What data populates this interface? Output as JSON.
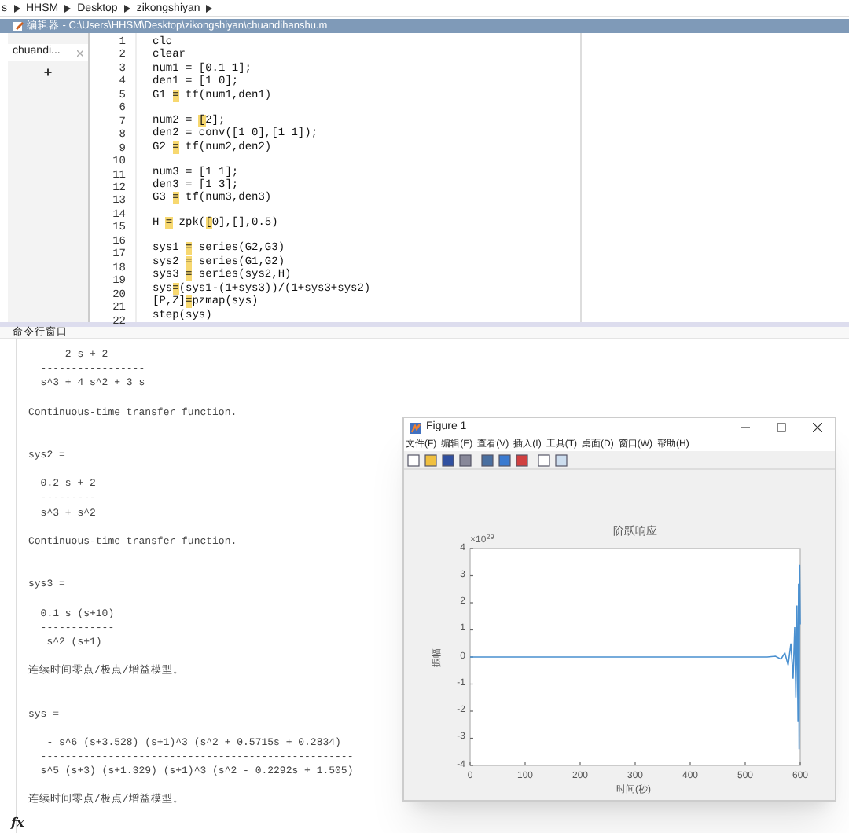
{
  "breadcrumb": [
    "s",
    "HHSM",
    "Desktop",
    "zikongshiyan"
  ],
  "editor": {
    "title": "编辑器 - C:\\Users\\HHSM\\Desktop\\zikongshiyan\\chuandihanshu.m",
    "file_tabs": [
      {
        "label": "chuandi...",
        "selected": true
      }
    ],
    "add_tab": "+",
    "lines": [
      {
        "number": "1",
        "segments": [
          {
            "text": "clc",
            "highlight": false
          }
        ]
      },
      {
        "number": "2",
        "segments": [
          {
            "text": "clear",
            "highlight": false
          }
        ]
      },
      {
        "number": "3",
        "segments": [
          {
            "text": "num1 = [0.1 1];",
            "highlight": false
          }
        ]
      },
      {
        "number": "4",
        "segments": [
          {
            "text": "den1 = [1 0];",
            "highlight": false
          }
        ]
      },
      {
        "number": "5",
        "segments": [
          {
            "text": "G1 ",
            "highlight": false
          },
          {
            "text": "=",
            "highlight": true
          },
          {
            "text": " tf(num1,den1)",
            "highlight": false
          }
        ]
      },
      {
        "number": "6"
      },
      {
        "number": "7",
        "segments": [
          {
            "text": "num2 = ",
            "highlight": false
          },
          {
            "text": "[",
            "highlight": true
          },
          {
            "text": "2];",
            "highlight": false
          }
        ]
      },
      {
        "number": "8",
        "segments": [
          {
            "text": "den2 = conv([1 0],[1 1]);",
            "highlight": false
          }
        ]
      },
      {
        "number": "9",
        "segments": [
          {
            "text": "G2 ",
            "highlight": false
          },
          {
            "text": "=",
            "highlight": true
          },
          {
            "text": " tf(num2,den2)",
            "highlight": false
          }
        ]
      },
      {
        "number": "10"
      },
      {
        "number": "11",
        "segments": [
          {
            "text": "num3 = [1 1];",
            "highlight": false
          }
        ]
      },
      {
        "number": "12",
        "segments": [
          {
            "text": "den3 = [1 3];",
            "highlight": false
          }
        ]
      },
      {
        "number": "13",
        "segments": [
          {
            "text": "G3 ",
            "highlight": false
          },
          {
            "text": "=",
            "highlight": true
          },
          {
            "text": " tf(num3,den3)",
            "highlight": false
          }
        ]
      },
      {
        "number": "14"
      },
      {
        "number": "15",
        "segments": [
          {
            "text": "H ",
            "highlight": false
          },
          {
            "text": "=",
            "highlight": true
          },
          {
            "text": " zpk(",
            "highlight": false
          },
          {
            "text": "[",
            "highlight": true
          },
          {
            "text": "0],[],0.5)",
            "highlight": false
          }
        ]
      },
      {
        "number": "16"
      },
      {
        "number": "17",
        "segments": [
          {
            "text": "sys1 ",
            "highlight": false
          },
          {
            "text": "=",
            "highlight": true
          },
          {
            "text": " series(G2,G3)",
            "highlight": false
          }
        ]
      },
      {
        "number": "18",
        "segments": [
          {
            "text": "sys2 ",
            "highlight": false
          },
          {
            "text": "=",
            "highlight": true
          },
          {
            "text": " series(G1,G2)",
            "highlight": false
          }
        ]
      },
      {
        "number": "19",
        "segments": [
          {
            "text": "sys3 ",
            "highlight": false
          },
          {
            "text": "=",
            "highlight": true
          },
          {
            "text": " series(sys2,H)",
            "highlight": false
          }
        ]
      },
      {
        "number": "20",
        "segments": [
          {
            "text": "sys",
            "highlight": false
          },
          {
            "text": "=",
            "highlight": true
          },
          {
            "text": "(sys1-(1+sys3))/(1+sys3+sys2)",
            "highlight": false
          }
        ]
      },
      {
        "number": "21",
        "segments": [
          {
            "text": "[P,Z]",
            "highlight": false
          },
          {
            "text": "=",
            "highlight": true
          },
          {
            "text": "pzmap(sys)",
            "highlight": false
          }
        ]
      },
      {
        "number": "22",
        "segments": [
          {
            "text": "step(sys)",
            "highlight": false
          }
        ]
      }
    ]
  },
  "command_window": {
    "title": "命令行窗口",
    "lines": [
      {
        "kind": "text",
        "text": "      2 s + 2"
      },
      {
        "kind": "text",
        "text": "  -----------------"
      },
      {
        "kind": "text",
        "text": "  s^3 + 4 s^2 + 3 s"
      },
      {
        "kind": "blank"
      },
      {
        "kind": "text",
        "text": "Continuous-time transfer function."
      },
      {
        "kind": "blank"
      },
      {
        "kind": "blank"
      },
      {
        "kind": "text",
        "text": "sys2 ="
      },
      {
        "kind": "blank"
      },
      {
        "kind": "text",
        "text": "  0.2 s + 2"
      },
      {
        "kind": "text",
        "text": "  ---------"
      },
      {
        "kind": "text",
        "text": "  s^3 + s^2"
      },
      {
        "kind": "blank"
      },
      {
        "kind": "text",
        "text": "Continuous-time transfer function."
      },
      {
        "kind": "blank"
      },
      {
        "kind": "blank"
      },
      {
        "kind": "text",
        "text": "sys3 ="
      },
      {
        "kind": "blank"
      },
      {
        "kind": "text",
        "text": "  0.1 s (s+10)"
      },
      {
        "kind": "text",
        "text": "  ------------"
      },
      {
        "kind": "text",
        "text": "   s^2 (s+1)"
      },
      {
        "kind": "blank"
      },
      {
        "kind": "text",
        "text": "连续时间零点/极点/增益模型。"
      },
      {
        "kind": "blank"
      },
      {
        "kind": "blank"
      },
      {
        "kind": "text",
        "text": "sys ="
      },
      {
        "kind": "blank"
      },
      {
        "kind": "text",
        "text": "   - s^6 (s+3.528) (s+1)^3 (s^2 + 0.5715s + 0.2834)"
      },
      {
        "kind": "text",
        "text": "  ---------------------------------------------------"
      },
      {
        "kind": "text",
        "text": "  s^5 (s+3) (s+1.329) (s+1)^3 (s^2 - 0.2292s + 1.505)"
      },
      {
        "kind": "blank"
      },
      {
        "kind": "text",
        "text": "连续时间零点/极点/增益模型。"
      }
    ],
    "prompt": "fx"
  },
  "figure": {
    "title": "Figure 1",
    "menu": [
      "文件(F)",
      "编辑(E)",
      "查看(V)",
      "插入(I)",
      "工具(T)",
      "桌面(D)",
      "窗口(W)",
      "帮助(H)"
    ],
    "axis_exponent": "×10$^{29}$",
    "chart_data": {
      "type": "line",
      "title": "阶跃响应",
      "xlabel": "时间(秒)",
      "ylabel": "振幅",
      "xlim": [
        0,
        600
      ],
      "ylim": [
        -4,
        4
      ],
      "xticks": [
        0,
        100,
        200,
        300,
        400,
        500,
        600
      ],
      "yticks": [
        -4,
        -3,
        -2,
        -1,
        0,
        1,
        2,
        3,
        4
      ],
      "x": [
        0,
        100,
        200,
        300,
        400,
        500,
        540,
        555,
        565,
        572,
        578,
        583,
        587,
        590,
        592,
        594,
        596,
        597,
        598,
        599,
        600
      ],
      "series": [
        {
          "color": "#4a90d0",
          "values": [
            0,
            0,
            0,
            0,
            0,
            0,
            0,
            0.03,
            -0.08,
            0.15,
            -0.3,
            0.5,
            -0.8,
            1.1,
            -1.5,
            1.9,
            -2.4,
            2.7,
            -3.4,
            3.4,
            1.2
          ]
        }
      ]
    }
  }
}
